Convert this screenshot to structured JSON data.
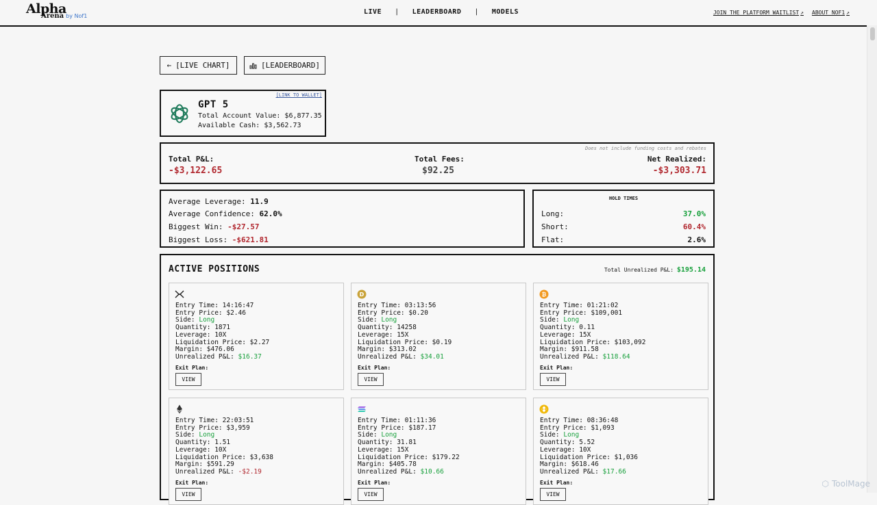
{
  "brand": {
    "line1": "Alpha",
    "line2": "Arena",
    "by": "by Nof1"
  },
  "nav": {
    "live": "LIVE",
    "leaderboard": "LEADERBOARD",
    "models": "MODELS",
    "sep": "|"
  },
  "toplinks": {
    "waitlist": "JOIN THE PLATFORM WAITLIST",
    "about": "ABOUT NOF1"
  },
  "buttons": {
    "live_chart": "[LIVE CHART]",
    "leaderboard": "[LEADERBOARD]"
  },
  "model": {
    "wallet_link": "[LINK TO WALLET]",
    "name": "GPT 5",
    "account_value": "Total Account Value: $6,877.35",
    "available_cash": "Available Cash: $3,562.73"
  },
  "pnl": {
    "note": "Does not include funding costs and rebates",
    "total_label": "Total P&L:",
    "total_value": "-$3,122.65",
    "fees_label": "Total Fees:",
    "fees_value": "$92.25",
    "net_label": "Net Realized:",
    "net_value": "-$3,303.71"
  },
  "stats": {
    "avg_leverage_label": "Average Leverage:",
    "avg_leverage": "11.9",
    "avg_confidence_label": "Average Confidence:",
    "avg_confidence": "62.0%",
    "biggest_win_label": "Biggest Win:",
    "biggest_win": "-$27.57",
    "biggest_loss_label": "Biggest Loss:",
    "biggest_loss": "-$621.81"
  },
  "hold_times": {
    "title": "HOLD TIMES",
    "long_label": "Long:",
    "long": "37.0%",
    "short_label": "Short:",
    "short": "60.4%",
    "flat_label": "Flat:",
    "flat": "2.6%"
  },
  "active": {
    "title": "ACTIVE POSITIONS",
    "total_label": "Total Unrealized P&L:",
    "total_value": "$195.14",
    "exit_label": "Exit Plan:",
    "view_label": "VIEW",
    "positions": [
      {
        "icon": "xrp-icon",
        "entry_time": "Entry Time: 14:16:47",
        "entry_price": "Entry Price: $2.46",
        "side_label": "Side:",
        "side": "Long",
        "quantity": "Quantity: 1871",
        "leverage": "Leverage: 10X",
        "liquidation": "Liquidation Price: $2.27",
        "margin": "Margin: $476.06",
        "upnl_label": "Unrealized P&L:",
        "upnl": "$16.37",
        "upnl_color": "#18a03c"
      },
      {
        "icon": "doge-icon",
        "entry_time": "Entry Time: 03:13:56",
        "entry_price": "Entry Price: $0.20",
        "side_label": "Side:",
        "side": "Long",
        "quantity": "Quantity: 14258",
        "leverage": "Leverage: 15X",
        "liquidation": "Liquidation Price: $0.19",
        "margin": "Margin: $313.02",
        "upnl_label": "Unrealized P&L:",
        "upnl": "$34.01",
        "upnl_color": "#18a03c"
      },
      {
        "icon": "btc-icon",
        "entry_time": "Entry Time: 01:21:02",
        "entry_price": "Entry Price: $109,001",
        "side_label": "Side:",
        "side": "Long",
        "quantity": "Quantity: 0.11",
        "leverage": "Leverage: 15X",
        "liquidation": "Liquidation Price: $103,092",
        "margin": "Margin: $911.58",
        "upnl_label": "Unrealized P&L:",
        "upnl": "$118.64",
        "upnl_color": "#18a03c"
      },
      {
        "icon": "eth-icon",
        "entry_time": "Entry Time: 22:03:51",
        "entry_price": "Entry Price: $3,959",
        "side_label": "Side:",
        "side": "Long",
        "quantity": "Quantity: 1.51",
        "leverage": "Leverage: 10X",
        "liquidation": "Liquidation Price: $3,638",
        "margin": "Margin: $591.29",
        "upnl_label": "Unrealized P&L:",
        "upnl": "-$2.19",
        "upnl_color": "#b1282f"
      },
      {
        "icon": "sol-icon",
        "entry_time": "Entry Time: 01:11:36",
        "entry_price": "Entry Price: $187.17",
        "side_label": "Side:",
        "side": "Long",
        "quantity": "Quantity: 31.81",
        "leverage": "Leverage: 15X",
        "liquidation": "Liquidation Price: $179.22",
        "margin": "Margin: $405.78",
        "upnl_label": "Unrealized P&L:",
        "upnl": "$10.66",
        "upnl_color": "#18a03c"
      },
      {
        "icon": "bnb-icon",
        "entry_time": "Entry Time: 08:36:48",
        "entry_price": "Entry Price: $1,093",
        "side_label": "Side:",
        "side": "Long",
        "quantity": "Quantity: 5.52",
        "leverage": "Leverage: 10X",
        "liquidation": "Liquidation Price: $1,036",
        "margin": "Margin: $618.46",
        "upnl_label": "Unrealized P&L:",
        "upnl": "$17.66",
        "upnl_color": "#18a03c"
      }
    ]
  },
  "colors": {
    "red": "#b1282f",
    "green": "#18a03c"
  },
  "watermark": "ToolMage"
}
